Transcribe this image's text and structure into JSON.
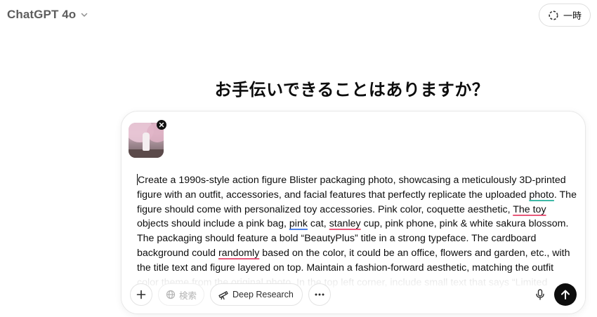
{
  "header": {
    "model_name": "ChatGPT 4o",
    "temporary_label": "一時"
  },
  "main": {
    "headline": "お手伝いできることはありますか？"
  },
  "composer": {
    "attachment": {
      "kind": "image",
      "alt": "uploaded photo thumbnail"
    },
    "prompt_segments": [
      {
        "t": "Create a 1990s-style action figure Blister packaging photo, showcasing a meticulously 3D-printed figure with an outfit, accessories, and facial features that perfectly replicate the uploaded "
      },
      {
        "t": "photo",
        "u": "teal"
      },
      {
        "t": ". The figure should come with personalized toy accessories. Pink color, coquette aesthetic, "
      },
      {
        "t": "The toy",
        "u": "red"
      },
      {
        "t": " objects should include a pink bag, "
      },
      {
        "t": "pink",
        "u": "blue"
      },
      {
        "t": " cat, "
      },
      {
        "t": "stanley",
        "u": "red"
      },
      {
        "t": " cup, pink phone, pink & white sakura blossom. The packaging should feature a bold “BeautyPlus” title in a strong typeface. The cardboard background could "
      },
      {
        "t": "randomly",
        "u": "red"
      },
      {
        "t": " based on the color, it could be an office, flowers and garden, etc., with the title text and figure layered on top. Maintain a fashion-forward aesthetic, matching the outfit color theme from the original photo. In the top left corner, include small text that says “Limited"
      }
    ],
    "toolbar": {
      "plus_icon": "plus-icon",
      "search_label": "検索",
      "deep_research_label": "Deep Research",
      "more_icon": "ellipsis-icon",
      "mic_icon": "microphone-icon",
      "send_icon": "arrow-up-icon"
    }
  },
  "colors": {
    "send_button": "#0d0d0d",
    "spell_red": "#e8587a",
    "spell_blue": "#4b7fe6",
    "spell_teal": "#3fb8a6"
  }
}
